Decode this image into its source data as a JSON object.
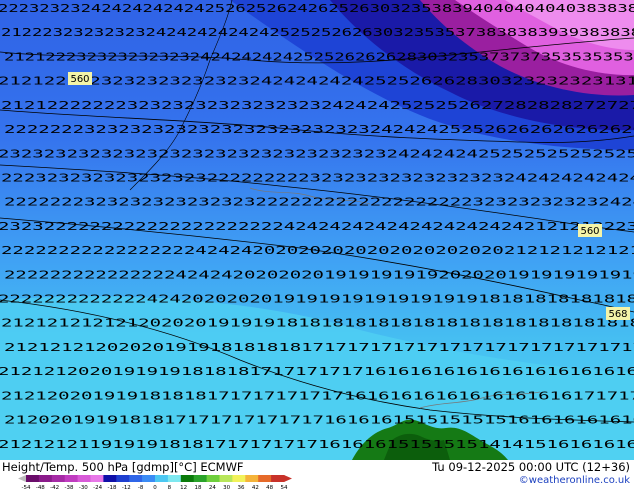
{
  "footer": {
    "title": "Height/Temp. 500 hPa [gdmp][°C] ECMWF",
    "valid_time": "Tu 09-12-2025 00:00 UTC (12+36)",
    "credit": "©weatheronline.co.uk"
  },
  "colorbar": {
    "ticks": [
      "-54",
      "-48",
      "-42",
      "-38",
      "-30",
      "-24",
      "-18",
      "-12",
      "-8",
      "0",
      "8",
      "12",
      "18",
      "24",
      "30",
      "36",
      "42",
      "48",
      "54"
    ],
    "colors": [
      "#6a0d6a",
      "#8a1a8a",
      "#a52aa5",
      "#c03cc0",
      "#d85ad8",
      "#e878e8",
      "#1010a8",
      "#1f3fd0",
      "#2f66e8",
      "#3b8cf5",
      "#4cc8f2",
      "#7ee8f0",
      "#0a7a0a",
      "#2aa32a",
      "#6ecf3c",
      "#b8e65a",
      "#f2f25a",
      "#f5b43a",
      "#e66a2a",
      "#c8322a"
    ]
  },
  "map": {
    "height_labels": [
      "560",
      "560",
      "568"
    ],
    "temperature_rows": [
      "22232323242424242424252625262426252630323538394040404040383838",
      "21222323232323242424242424252525262630323535373838383939383838",
      "21212223232323232324242424242525262626283032353737373535353535",
      "21212222232323232323232424242424252526262830323232323131",
      "21212222222323232323232323232424242525252627282828272727",
      "22222223232323232323232323232323242424252526262626262626",
      "23232323232323232323232323232323232424242425252525252525",
      "22232323232323232322222222232323232323232323242424242424",
      "22222223232323232323232222222222222222222323232323232424",
      "23232222222222222222222224242424242424242424242121212223",
      "22222222222222222424242020202020202020202020212121212121",
      "22222222222222242424202020201919191919202020191919191919",
      "22222222222224242020202019191919191919191918181818181818",
      "21212121212120202019191918181818181818181818181818181818",
      "21212121202020191918181818171717171717171717171717171717",
      "21212120201919191818181717171717161616161616161616161616",
      "21212020191918181817171717171716161616161616161616171717",
      "21202019191818171717171717171616161515151515161616161616",
      "21212121191919181817171717171616161515151514141516161616"
    ]
  }
}
